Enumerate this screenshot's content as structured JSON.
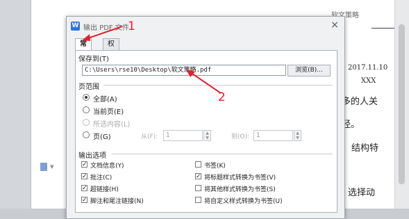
{
  "document": {
    "header_text": "软文策略",
    "date": "2017.11.10",
    "text_xxx": "XXX",
    "line1": "多的人关",
    "line2": "经。",
    "line3": "结构特",
    "line4": "选择动"
  },
  "dialog": {
    "title": "输出 PDF 文件",
    "app_icon": "W",
    "close": "×",
    "tabs": [
      "常规",
      "权限设置"
    ],
    "save_to": {
      "label": "保存到(T)",
      "path": "C:\\Users\\rse10\\Desktop\\软文策略.pdf",
      "browse": "浏览(B)..."
    },
    "page_range": {
      "label": "页范围",
      "all": "全部(A)",
      "current": "当前页(E)",
      "selection": "所选内容(L)",
      "pages": "页(G)",
      "from_label": "从(F):",
      "from_value": "1",
      "to_label": "到(O):",
      "to_value": "1"
    },
    "output_options": {
      "label": "输出选项",
      "left": [
        {
          "label": "文档信息(Y)",
          "checked": true
        },
        {
          "label": "批注(C)",
          "checked": true
        },
        {
          "label": "超链接(H)",
          "checked": true
        },
        {
          "label": "脚注和尾注链接(N)",
          "checked": true
        }
      ],
      "right": [
        {
          "label": "书签(K)",
          "checked": false
        },
        {
          "label": "将标题样式转换为书签(V)",
          "checked": true
        },
        {
          "label": "将其他样式转换为书签(S)",
          "checked": false
        },
        {
          "label": "将自定义样式转换为书签(U)",
          "checked": false
        }
      ]
    }
  },
  "annotations": {
    "one": "1",
    "two": "2",
    "color": "#e3202c"
  }
}
